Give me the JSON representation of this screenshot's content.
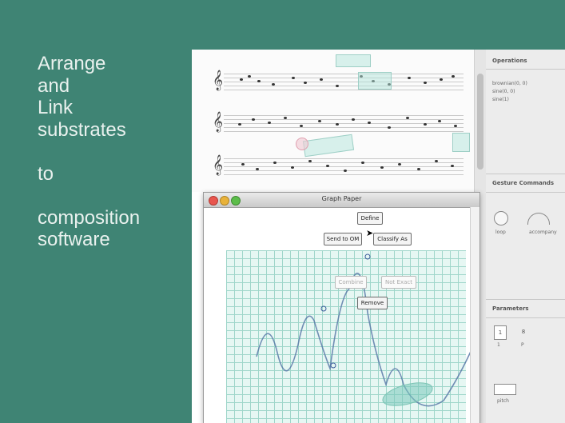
{
  "slide": {
    "lines": [
      "Arrange",
      "and",
      "Link",
      "substrates",
      "",
      "to",
      "",
      "composition",
      "software"
    ]
  },
  "inspector": {
    "operations_title": "Operations",
    "operations_items": [
      "brownian(0, 0)",
      "sine(0, 0)",
      "sine(1)"
    ],
    "gesture_title": "Gesture Commands",
    "gesture_label_1": "loop",
    "gesture_label_2": "accompany",
    "parameters_title": "Parameters",
    "param_labels": [
      "1",
      "P"
    ],
    "param_icon_1": "1",
    "param_icon_2": "8",
    "bottom_label": "pitch"
  },
  "graph_window": {
    "title": "Graph Paper",
    "buttons": {
      "define": "Define",
      "send_to_om": "Send to OM",
      "classify": "Classify As",
      "combine": "Combine",
      "remove": "Remove",
      "not_exact": "Not Exact"
    }
  },
  "colors": {
    "slide_bg": "#3f8474",
    "slide_text": "#e9f1ee",
    "grid_bg": "#e6f7f3",
    "grid_line": "#9fd6ca"
  },
  "icons": {
    "window_close": "red-circle",
    "window_minimize": "yellow-circle",
    "window_zoom": "green-circle",
    "pointer": "arrow-cursor"
  }
}
